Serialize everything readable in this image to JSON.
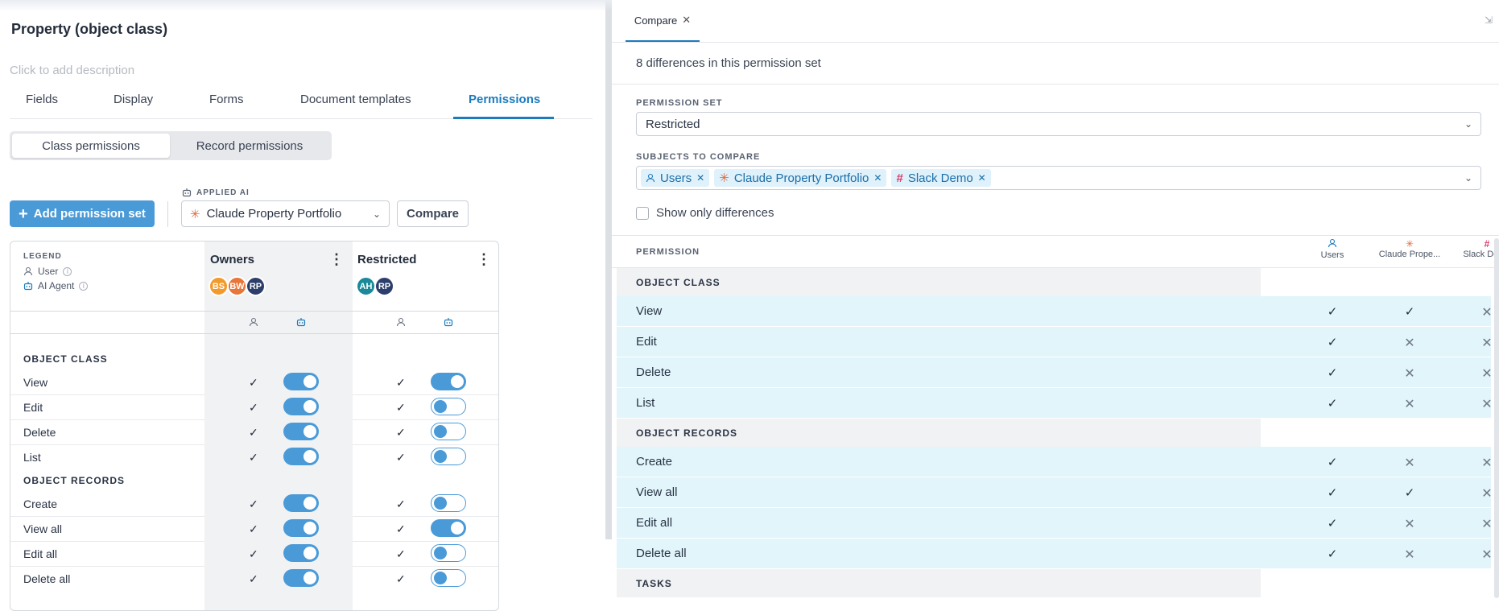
{
  "left": {
    "title": "Property (object class)",
    "description_placeholder": "Click to add description",
    "tabs": [
      "Fields",
      "Display",
      "Forms",
      "Document templates",
      "Permissions"
    ],
    "active_tab": "Permissions",
    "segment": {
      "class": "Class permissions",
      "record": "Record permissions"
    },
    "add_button": "Add permission set",
    "applied_ai_label": "APPLIED AI",
    "applied_ai_value": "Claude Property Portfolio",
    "compare_button": "Compare",
    "legend": {
      "label": "LEGEND",
      "user": "User",
      "ai_agent": "AI Agent"
    },
    "sets": [
      {
        "name": "Owners",
        "avatars": [
          {
            "initials": "BS",
            "color": "#f39a2d"
          },
          {
            "initials": "BW",
            "color": "#e8753a"
          },
          {
            "initials": "RP",
            "color": "#2c3e6b"
          }
        ]
      },
      {
        "name": "Restricted",
        "avatars": [
          {
            "initials": "AH",
            "color": "#1a8a9a"
          },
          {
            "initials": "RP",
            "color": "#2c3e6b"
          }
        ]
      }
    ],
    "sections": [
      {
        "title": "OBJECT CLASS",
        "rows": [
          {
            "label": "View",
            "owners_user": "✓",
            "owners_ai": true,
            "restricted_user": "✓",
            "restricted_ai": true
          },
          {
            "label": "Edit",
            "owners_user": "✓",
            "owners_ai": true,
            "restricted_user": "✓",
            "restricted_ai": false
          },
          {
            "label": "Delete",
            "owners_user": "✓",
            "owners_ai": true,
            "restricted_user": "✓",
            "restricted_ai": false
          },
          {
            "label": "List",
            "owners_user": "✓",
            "owners_ai": true,
            "restricted_user": "✓",
            "restricted_ai": false
          }
        ]
      },
      {
        "title": "OBJECT RECORDS",
        "rows": [
          {
            "label": "Create",
            "owners_user": "✓",
            "owners_ai": true,
            "restricted_user": "✓",
            "restricted_ai": false
          },
          {
            "label": "View all",
            "owners_user": "✓",
            "owners_ai": true,
            "restricted_user": "✓",
            "restricted_ai": true
          },
          {
            "label": "Edit all",
            "owners_user": "✓",
            "owners_ai": true,
            "restricted_user": "✓",
            "restricted_ai": false
          },
          {
            "label": "Delete all",
            "owners_user": "✓",
            "owners_ai": true,
            "restricted_user": "✓",
            "restricted_ai": false
          }
        ]
      }
    ]
  },
  "right": {
    "tab_label": "Compare",
    "summary": "8 differences in this permission set",
    "permission_set_label": "PERMISSION SET",
    "permission_set_value": "Restricted",
    "subjects_label": "SUBJECTS TO COMPARE",
    "subjects": [
      "Users",
      "Claude Property Portfolio",
      "Slack Demo"
    ],
    "show_only_differences": "Show only differences",
    "permission_header": "PERMISSION",
    "columns": [
      "Users",
      "Claude Prope...",
      "Slack Demo"
    ],
    "sections": [
      {
        "title": "OBJECT CLASS",
        "rows": [
          {
            "label": "View",
            "values": [
              "✓",
              "✓",
              "✕"
            ]
          },
          {
            "label": "Edit",
            "values": [
              "✓",
              "✕",
              "✕"
            ]
          },
          {
            "label": "Delete",
            "values": [
              "✓",
              "✕",
              "✕"
            ]
          },
          {
            "label": "List",
            "values": [
              "✓",
              "✕",
              "✕"
            ]
          }
        ]
      },
      {
        "title": "OBJECT RECORDS",
        "rows": [
          {
            "label": "Create",
            "values": [
              "✓",
              "✕",
              "✕"
            ]
          },
          {
            "label": "View all",
            "values": [
              "✓",
              "✓",
              "✕"
            ]
          },
          {
            "label": "Edit all",
            "values": [
              "✓",
              "✕",
              "✕"
            ]
          },
          {
            "label": "Delete all",
            "values": [
              "✓",
              "✕",
              "✕"
            ]
          }
        ]
      },
      {
        "title": "TASKS",
        "rows": []
      }
    ]
  },
  "colors": {
    "accent": "#1d7bbd",
    "button": "#4a9ad8",
    "diff_row": "#e1f5fb"
  }
}
